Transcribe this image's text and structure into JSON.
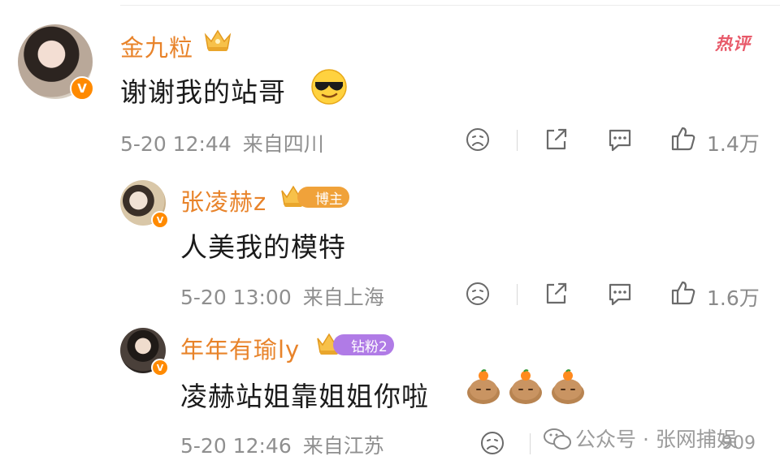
{
  "comments": [
    {
      "user": "金九粒",
      "badge": "",
      "text": "谢谢我的站哥",
      "time": "5-20 12:44",
      "location": "来自四川",
      "likes": "1.4万",
      "hot_label": "热评",
      "verified": "V"
    },
    {
      "user": "张凌赫z",
      "badge": "博主",
      "text": "人美我的模特",
      "time": "5-20 13:00",
      "location": "来自上海",
      "likes": "1.6万",
      "verified": "V"
    },
    {
      "user": "年年有瑜ly",
      "badge": "钻粉2",
      "text": "凌赫站姐靠姐姐你啦",
      "time": "5-20 12:46",
      "location": "来自江苏",
      "likes": "",
      "verified": "V"
    }
  ],
  "watermark": {
    "text": "公众号 · 张网捕娱",
    "count": "909"
  },
  "icons": {
    "dislike": "sad-face-icon",
    "repost": "share-icon",
    "comment": "comment-icon",
    "like": "thumbs-up-icon",
    "wechat": "wechat-icon"
  },
  "colors": {
    "username": "#e8832a",
    "hot": "#e85a6a",
    "badge_blogger": "#f0a23a",
    "badge_fan": "#b07be6",
    "verified": "#ff8a00"
  }
}
